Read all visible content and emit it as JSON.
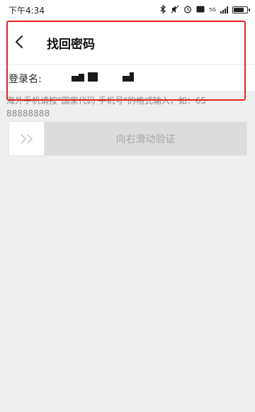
{
  "status_bar": {
    "time": "下午4:34",
    "network_label": "5G"
  },
  "header": {
    "title": "找回密码"
  },
  "form": {
    "login_label": "登录名:"
  },
  "hint": "海外手机请按\"国家代码 手机号\"的格式输入，如：65 88888888",
  "slider": {
    "label": "向右滑动验证"
  },
  "colors": {
    "highlight": "#e8201d",
    "background": "#efefef"
  }
}
